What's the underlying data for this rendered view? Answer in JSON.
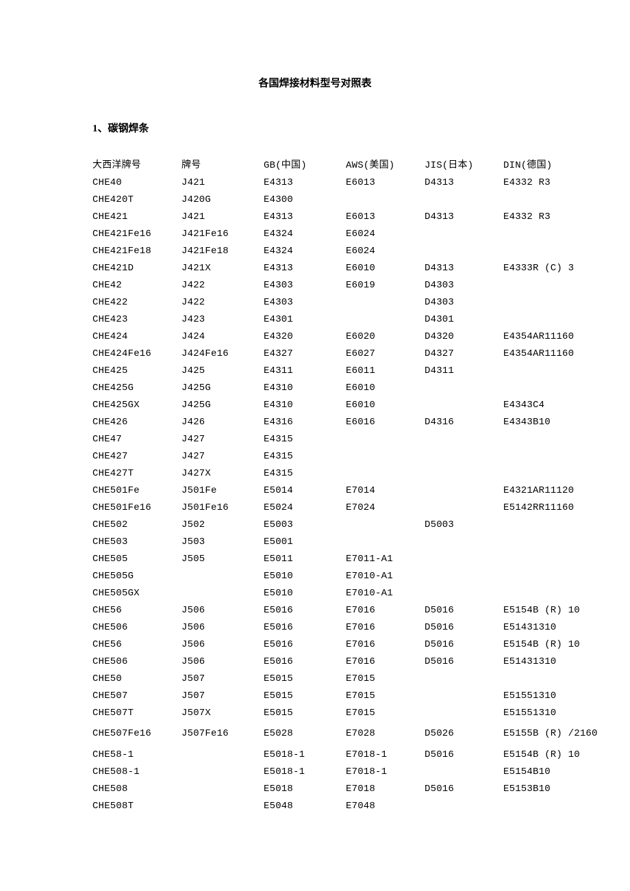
{
  "title": "各国焊接材料型号对照表",
  "section_heading": "1、碳钢焊条",
  "headers": [
    "大西洋牌号",
    "牌号",
    "GB(中国)",
    "AWS(美国)",
    "JIS(日本)",
    "DIN(德国)"
  ],
  "rows": [
    [
      "CHE40",
      "J421",
      "E4313",
      "E6013",
      "D4313",
      "E4332 R3"
    ],
    [
      "CHE420T",
      "J420G",
      "E4300",
      "",
      "",
      ""
    ],
    [
      "CHE421",
      "J421",
      "E4313",
      "E6013",
      "D4313",
      "E4332 R3"
    ],
    [
      "CHE421Fe16",
      "J421Fe16",
      "E4324",
      "E6024",
      "",
      ""
    ],
    [
      "CHE421Fe18",
      "J421Fe18",
      "E4324",
      "E6024",
      "",
      ""
    ],
    [
      "CHE421D",
      "J421X",
      "E4313",
      "E6010",
      "D4313",
      "E4333R (C) 3"
    ],
    [
      "CHE42",
      "J422",
      "E4303",
      "E6019",
      "D4303",
      ""
    ],
    [
      "CHE422",
      "J422",
      "E4303",
      "",
      "D4303",
      ""
    ],
    [
      "CHE423",
      "J423",
      "E4301",
      "",
      "D4301",
      ""
    ],
    [
      "CHE424",
      "J424",
      "E4320",
      "E6020",
      "D4320",
      "E4354AR11160"
    ],
    [
      "CHE424Fe16",
      "J424Fe16",
      "E4327",
      "E6027",
      "D4327",
      "E4354AR11160"
    ],
    [
      "CHE425",
      "J425",
      "E4311",
      "E6011",
      "D4311",
      ""
    ],
    [
      "CHE425G",
      "J425G",
      "E4310",
      "E6010",
      "",
      ""
    ],
    [
      "CHE425GX",
      "J425G",
      "E4310",
      "E6010",
      "",
      "E4343C4"
    ],
    [
      "CHE426",
      "J426",
      "E4316",
      "E6016",
      "D4316",
      "E4343B10"
    ],
    [
      "CHE47",
      "J427",
      "E4315",
      "",
      "",
      ""
    ],
    [
      "CHE427",
      "J427",
      "E4315",
      "",
      "",
      ""
    ],
    [
      "CHE427T",
      "J427X",
      "E4315",
      "",
      "",
      ""
    ],
    [
      "CHE501Fe",
      "J501Fe",
      "E5014",
      "E7014",
      "",
      "E4321AR11120"
    ],
    [
      "CHE501Fe16",
      "J501Fe16",
      "E5024",
      "E7024",
      "",
      "E5142RR11160"
    ],
    [
      "CHE502",
      "J502",
      "E5003",
      "",
      "D5003",
      ""
    ],
    [
      "CHE503",
      "J503",
      "E5001",
      "",
      "",
      ""
    ],
    [
      "CHE505",
      "J505",
      "E5011",
      "E7011-A1",
      "",
      ""
    ],
    [
      "CHE505G",
      "",
      "E5010",
      "E7010-A1",
      "",
      ""
    ],
    [
      "CHE505GX",
      "",
      "E5010",
      "E7010-A1",
      "",
      ""
    ],
    [
      "CHE56",
      "J506",
      "E5016",
      "E7016",
      "D5016",
      "E5154B (R) 10"
    ],
    [
      "CHE506",
      "J506",
      "E5016",
      "E7016",
      "D5016",
      "E51431310"
    ],
    [
      "CHE56",
      "J506",
      "E5016",
      "E7016",
      "D5016",
      "E5154B (R) 10"
    ],
    [
      "CHE506",
      "J506",
      "E5016",
      "E7016",
      "D5016",
      "E51431310"
    ],
    [
      "CHE50",
      "J507",
      "E5015",
      "E7015",
      "",
      ""
    ],
    [
      "CHE507",
      "J507",
      "E5015",
      "E7015",
      "",
      "E51551310"
    ],
    [
      "CHE507T",
      "J507X",
      "E5015",
      "E7015",
      "",
      "E51551310"
    ],
    [
      "CHE507Fe16",
      "J507Fe16",
      "E5028",
      "E7028",
      "D5026",
      "E5155B (R) /2160"
    ],
    [
      "CHE58-1",
      "",
      "E5018-1",
      "E7018-1",
      "D5016",
      "E5154B (R) 10"
    ],
    [
      "CHE508-1",
      "",
      "E5018-1",
      "E7018-1",
      "",
      "E5154B10"
    ],
    [
      "CHE508",
      "",
      "E5018",
      "E7018",
      "D5016",
      "E5153B10"
    ],
    [
      "CHE508T",
      "",
      "E5048",
      "E7048",
      "",
      ""
    ]
  ]
}
